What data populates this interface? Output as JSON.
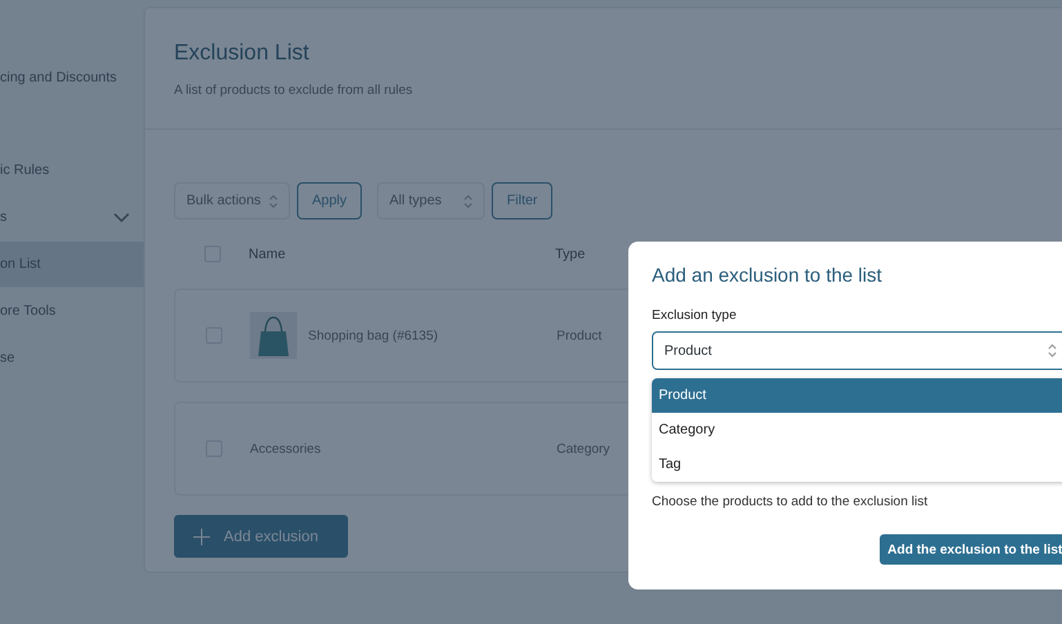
{
  "sidebar": {
    "items": [
      {
        "label": "cing and Discounts",
        "selected": false,
        "submenu": false
      },
      {
        "label": "ic Rules",
        "selected": false,
        "submenu": false
      },
      {
        "label": "s",
        "selected": false,
        "submenu": true
      },
      {
        "label": "on List",
        "selected": true,
        "submenu": false
      },
      {
        "label": "ore Tools",
        "selected": false,
        "submenu": false
      },
      {
        "label": "se",
        "selected": false,
        "submenu": false
      }
    ]
  },
  "page": {
    "title": "Exclusion List",
    "subtitle": "A list of products to exclude from all rules"
  },
  "toolbar": {
    "bulk_select": "Bulk actions",
    "apply_button": "Apply",
    "type_select": "All types",
    "filter_button": "Filter"
  },
  "table": {
    "columns": [
      "Name",
      "Type"
    ],
    "header_checked": false,
    "rows": [
      {
        "kind": "product",
        "name": "Shopping bag (#6135)",
        "type": "Product",
        "checked": false
      },
      {
        "kind": "category",
        "name": "Accessories",
        "type": "Category",
        "checked": false
      }
    ]
  },
  "add_button": "Add exclusion",
  "modal": {
    "title": "Add an exclusion to the list",
    "field_label": "Exclusion type",
    "field_value": "Product",
    "options": [
      {
        "label": "Product",
        "selected": true
      },
      {
        "label": "Category",
        "selected": false
      },
      {
        "label": "Tag",
        "selected": false
      }
    ],
    "helper": "Choose the products to add to the exclusion list",
    "submit_button": "Add the exclusion to the list"
  }
}
